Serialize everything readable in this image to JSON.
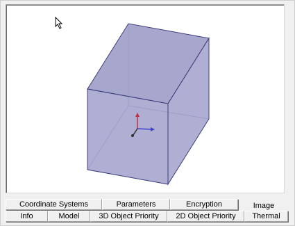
{
  "viewport": {
    "shape": "box",
    "fill_color": "#9d9dc9",
    "edge_color": "#3c3c7a",
    "axis_colors": {
      "z": "#c0304a",
      "x": "#4040c8",
      "y": "#303030"
    }
  },
  "tabs": {
    "row1": [
      {
        "label": "Coordinate Systems"
      },
      {
        "label": "Parameters"
      },
      {
        "label": "Encryption"
      },
      {
        "label": "Image",
        "active": true
      }
    ],
    "row2": [
      {
        "label": "Info"
      },
      {
        "label": "Model"
      },
      {
        "label": "3D Object Priority"
      },
      {
        "label": "2D Object Priority"
      },
      {
        "label": "Thermal"
      }
    ]
  }
}
